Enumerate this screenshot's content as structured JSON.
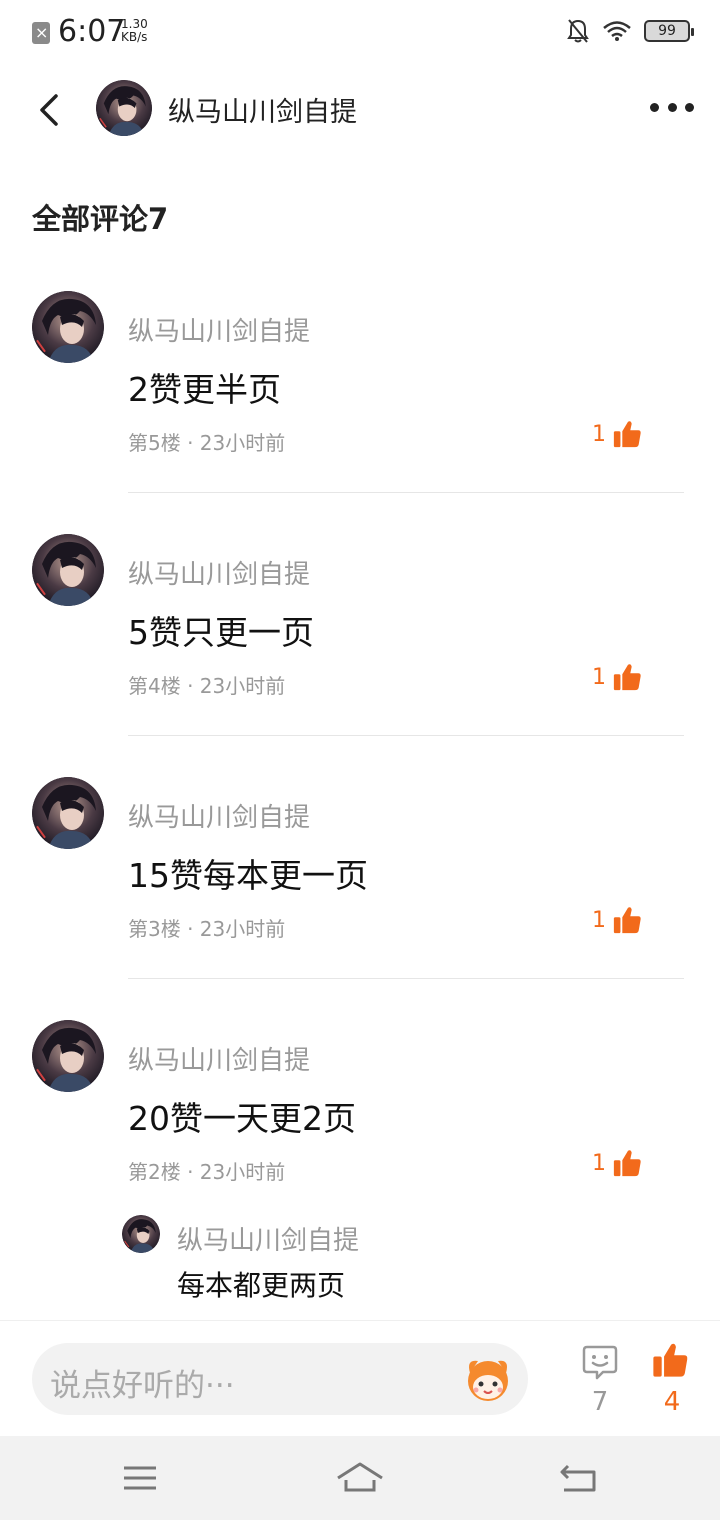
{
  "status_bar": {
    "time": "6:07",
    "speed_value": "1.30",
    "speed_unit": "KB/s",
    "battery": "99"
  },
  "header": {
    "title": "纵马山川剑自提"
  },
  "section": {
    "title": "全部评论7"
  },
  "comments": [
    {
      "author": "纵马山川剑自提",
      "text": "2赞更半页",
      "meta": "第5楼 · 23小时前",
      "likes": "1"
    },
    {
      "author": "纵马山川剑自提",
      "text": "5赞只更一页",
      "meta": "第4楼 · 23小时前",
      "likes": "1"
    },
    {
      "author": "纵马山川剑自提",
      "text": "15赞每本更一页",
      "meta": "第3楼 · 23小时前",
      "likes": "1"
    },
    {
      "author": "纵马山川剑自提",
      "text": "20赞一天更2页",
      "meta": "第2楼 · 23小时前",
      "likes": "1"
    }
  ],
  "reply": {
    "author": "纵马山川剑自提",
    "text": "每本都更两页"
  },
  "bottom_bar": {
    "input_placeholder": "说点好听的···",
    "comment_count": "7",
    "like_count": "4"
  },
  "colors": {
    "accent": "#f26a1b",
    "muted_text": "#999999",
    "input_bg": "#f2f2f2",
    "nav_bg": "#f2f2f2"
  },
  "icons": [
    "sim-off-icon",
    "mute-bell-icon",
    "wifi-icon",
    "battery-icon",
    "back-arrow-icon",
    "more-icon",
    "thumbs-up-icon",
    "emoji-icon",
    "comment-bubble-icon",
    "menu-icon",
    "home-icon",
    "back-nav-icon"
  ]
}
